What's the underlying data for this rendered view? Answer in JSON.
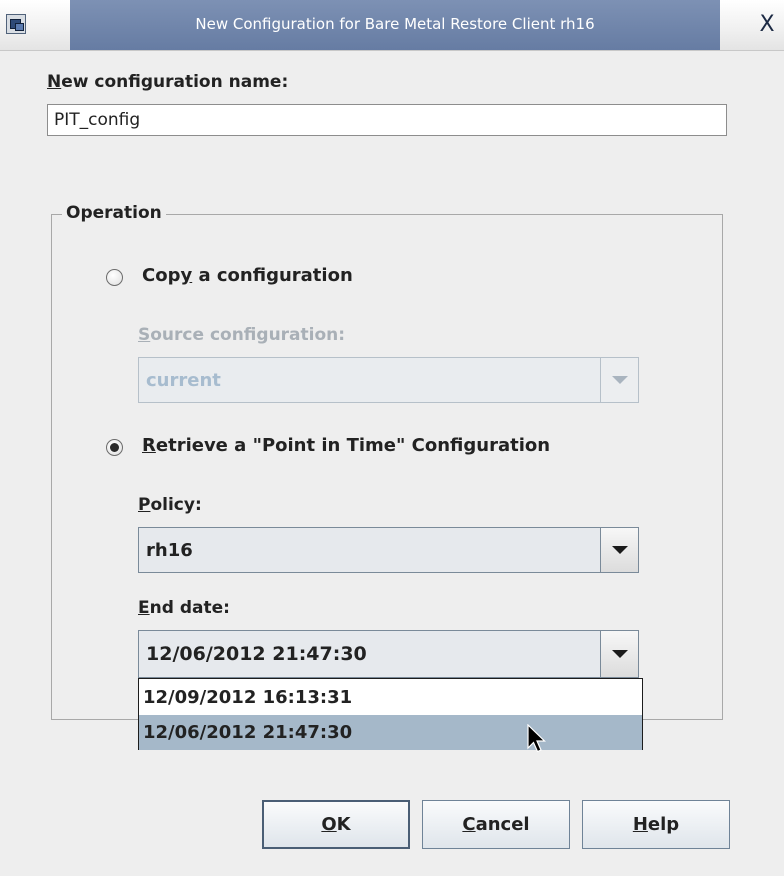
{
  "window": {
    "title": "New Configuration for Bare Metal Restore Client rh16",
    "close_glyph": "X"
  },
  "name_field": {
    "label_mnemonic": "N",
    "label_rest": "ew configuration name:",
    "value": "PIT_config"
  },
  "operation": {
    "group_title": "Operation",
    "copy_option": {
      "label_pre": "Cop",
      "label_mnemonic": "y",
      "label_post": " a configuration",
      "selected": false
    },
    "source_config": {
      "label_mnemonic": "S",
      "label_rest": "ource configuration:",
      "value": "current",
      "enabled": false
    },
    "retrieve_option": {
      "label_mnemonic": "R",
      "label_rest": "etrieve a \"Point in Time\" Configuration",
      "selected": true
    },
    "policy": {
      "label_mnemonic": "P",
      "label_rest": "olicy:",
      "value": "rh16"
    },
    "end_date": {
      "label_mnemonic": "E",
      "label_rest": "nd date:",
      "value": "12/06/2012 21:47:30",
      "options": [
        "12/09/2012 16:13:31",
        "12/06/2012 21:47:30"
      ],
      "highlighted_index": 1
    }
  },
  "buttons": {
    "ok": {
      "mnemonic": "O",
      "rest": "K"
    },
    "cancel": {
      "mnemonic": "C",
      "rest": "ancel"
    },
    "help": {
      "mnemonic": "H",
      "rest": "elp"
    }
  }
}
